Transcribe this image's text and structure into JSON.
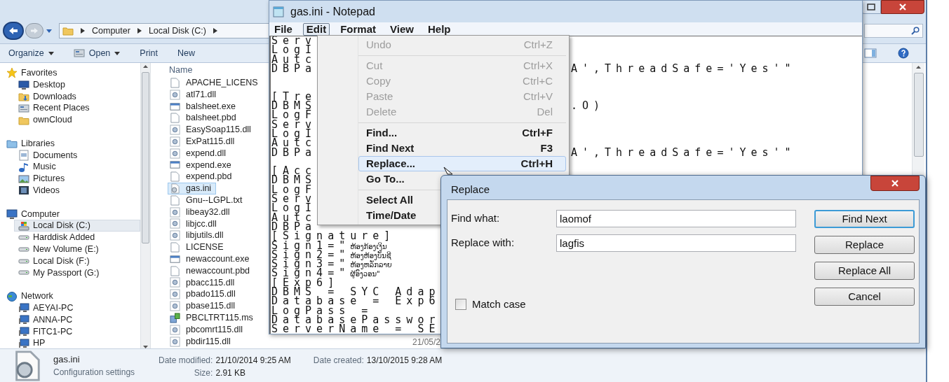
{
  "explorer": {
    "breadcrumb": [
      "Computer",
      "Local Disk (C:)"
    ],
    "toolbar": [
      {
        "label": "Organize",
        "kind": "menu"
      },
      {
        "label": "Open",
        "kind": "open"
      },
      {
        "label": "Print",
        "kind": "plain"
      },
      {
        "label": "New",
        "kind": "plain"
      }
    ],
    "nav": [
      {
        "label": "Favorites",
        "kind": "star",
        "selected": false,
        "children": [
          {
            "label": "Desktop",
            "kind": "desktop",
            "selected": false
          },
          {
            "label": "Downloads",
            "kind": "downloads",
            "selected": false
          },
          {
            "label": "Recent Places",
            "kind": "recent",
            "selected": false
          },
          {
            "label": "ownCloud",
            "kind": "folder",
            "selected": false
          }
        ]
      },
      {
        "label": "Libraries",
        "kind": "library",
        "selected": false,
        "children": [
          {
            "label": "Documents",
            "kind": "document",
            "selected": false
          },
          {
            "label": "Music",
            "kind": "music",
            "selected": false
          },
          {
            "label": "Pictures",
            "kind": "pictures",
            "selected": false
          },
          {
            "label": "Videos",
            "kind": "videos",
            "selected": false
          }
        ]
      },
      {
        "label": "Computer",
        "kind": "computer",
        "selected": false,
        "children": [
          {
            "label": "Local Disk (C:)",
            "kind": "os_drive",
            "selected": true
          },
          {
            "label": "Harddisk Added",
            "kind": "drive",
            "selected": false
          },
          {
            "label": "New Volume (E:)",
            "kind": "drive",
            "selected": false
          },
          {
            "label": "Local Disk (F:)",
            "kind": "drive",
            "selected": false
          },
          {
            "label": "My Passport (G:)",
            "kind": "drive",
            "selected": false
          }
        ]
      },
      {
        "label": "Network",
        "kind": "network",
        "selected": false,
        "children": [
          {
            "label": "AEYAI-PC",
            "kind": "pc",
            "selected": false
          },
          {
            "label": "ANNA-PC",
            "kind": "pc",
            "selected": false
          },
          {
            "label": "FITC1-PC",
            "kind": "pc",
            "selected": false
          },
          {
            "label": "HP",
            "kind": "pc",
            "selected": false
          }
        ]
      }
    ],
    "column_header": "Name",
    "files": [
      {
        "name": "APACHE_LICENS",
        "kind": "file",
        "selected": false
      },
      {
        "name": "atl71.dll",
        "kind": "dll",
        "selected": false
      },
      {
        "name": "balsheet.exe",
        "kind": "exe",
        "selected": false
      },
      {
        "name": "balsheet.pbd",
        "kind": "file",
        "selected": false
      },
      {
        "name": "EasySoap115.dll",
        "kind": "dll",
        "selected": false
      },
      {
        "name": "ExPat115.dll",
        "kind": "dll",
        "selected": false
      },
      {
        "name": "expend.dll",
        "kind": "dll",
        "selected": false
      },
      {
        "name": "expend.exe",
        "kind": "exe",
        "selected": false
      },
      {
        "name": "expend.pbd",
        "kind": "file",
        "selected": false
      },
      {
        "name": "gas.ini",
        "kind": "ini",
        "selected": true
      },
      {
        "name": "Gnu--LGPL.txt",
        "kind": "file",
        "selected": false
      },
      {
        "name": "libeay32.dll",
        "kind": "dll",
        "selected": false
      },
      {
        "name": "libjcc.dll",
        "kind": "dll",
        "selected": false
      },
      {
        "name": "libjutils.dll",
        "kind": "dll",
        "selected": false
      },
      {
        "name": "LICENSE",
        "kind": "file",
        "selected": false
      },
      {
        "name": "newaccount.exe",
        "kind": "exe",
        "selected": false
      },
      {
        "name": "newaccount.pbd",
        "kind": "file",
        "selected": false
      },
      {
        "name": "pbacc115.dll",
        "kind": "dll",
        "selected": false
      },
      {
        "name": "pbado115.dll",
        "kind": "dll",
        "selected": false
      },
      {
        "name": "pbase115.dll",
        "kind": "dll",
        "selected": false
      },
      {
        "name": "PBCLTRT115.ms",
        "kind": "msi",
        "selected": false
      },
      {
        "name": "pbcomrt115.dll",
        "kind": "dll",
        "selected": false
      },
      {
        "name": "pbdir115.dll",
        "kind": "dll",
        "selected": false,
        "date": "21/05/2"
      }
    ],
    "details": {
      "name": "gas.ini",
      "type": "Configuration settings",
      "modified_label": "Date modified:",
      "modified": "21/10/2014 9:25 AM",
      "size_label": "Size:",
      "size": "2.91 KB",
      "created_label": "Date created:",
      "created": "13/10/2015 9:28 AM"
    }
  },
  "notepad": {
    "title": "gas.ini - Notepad",
    "menu": [
      {
        "label": "File",
        "selected": false
      },
      {
        "label": "Edit",
        "selected": true
      },
      {
        "label": "Format",
        "selected": false
      },
      {
        "label": "View",
        "selected": false
      },
      {
        "label": "Help",
        "selected": false
      }
    ],
    "lines": [
      {
        "kind": "text",
        "text": "Serv"
      },
      {
        "kind": "text",
        "text": "LogI"
      },
      {
        "kind": "text",
        "text": "Autc"
      },
      {
        "kind": "text",
        "text": "DBPa",
        "right": "A',ThreadSafe='Yes'\""
      },
      {
        "kind": "blank"
      },
      {
        "kind": "blank"
      },
      {
        "kind": "text",
        "text": "[Tre"
      },
      {
        "kind": "text",
        "text": "DBMS",
        "right": ".O)"
      },
      {
        "kind": "text",
        "text": "LogF"
      },
      {
        "kind": "text",
        "text": "Serv"
      },
      {
        "kind": "text",
        "text": "LogI"
      },
      {
        "kind": "text",
        "text": "Autc"
      },
      {
        "kind": "text",
        "text": "DBPa",
        "right": "A',ThreadSafe='Yes'\""
      },
      {
        "kind": "blank"
      },
      {
        "kind": "text",
        "text": "[Acc"
      },
      {
        "kind": "text",
        "text": "DBMS"
      },
      {
        "kind": "text",
        "text": "LogF"
      },
      {
        "kind": "text",
        "text": "Serv"
      },
      {
        "kind": "text",
        "text": "LogI"
      },
      {
        "kind": "text",
        "text": "Autc"
      },
      {
        "kind": "text",
        "text": "DBPa"
      },
      {
        "kind": "text",
        "text": "[Signature]"
      },
      {
        "kind": "text",
        "text": "Sign1=\"",
        "tail": "ຫ້ອງກ້ອງເງິນ"
      },
      {
        "kind": "text",
        "text": "Sign2=\"",
        "tail": "ຫ້ອງຫ້ອງບັນຊີ"
      },
      {
        "kind": "text",
        "text": "Sign3=\"",
        "tail": "ຫ້ອງຫລັກລາຍ"
      },
      {
        "kind": "text",
        "text": "Sign4=\"",
        "tail": "ຜູ້ອົງວອນ\""
      },
      {
        "kind": "text",
        "text": "[Exp6]"
      },
      {
        "kind": "text",
        "text": "DBMS = SYC Adap"
      },
      {
        "kind": "text",
        "text": "Database = Exp6"
      },
      {
        "kind": "text",
        "text": "LogPass ="
      },
      {
        "kind": "text",
        "text": "DatabasePasswor"
      },
      {
        "kind": "text",
        "text": "ServerName = SE"
      }
    ],
    "edit_menu": [
      {
        "kind": "item",
        "label": "Undo",
        "shortcut": "Ctrl+Z",
        "disabled": true,
        "selected": false
      },
      {
        "kind": "separator"
      },
      {
        "kind": "item",
        "label": "Cut",
        "shortcut": "Ctrl+X",
        "disabled": true,
        "selected": false
      },
      {
        "kind": "item",
        "label": "Copy",
        "shortcut": "Ctrl+C",
        "disabled": true,
        "selected": false
      },
      {
        "kind": "item",
        "label": "Paste",
        "shortcut": "Ctrl+V",
        "disabled": true,
        "selected": false
      },
      {
        "kind": "item",
        "label": "Delete",
        "shortcut": "Del",
        "disabled": true,
        "selected": false
      },
      {
        "kind": "separator"
      },
      {
        "kind": "item",
        "label": "Find...",
        "shortcut": "Ctrl+F",
        "disabled": false,
        "selected": false
      },
      {
        "kind": "item",
        "label": "Find Next",
        "shortcut": "F3",
        "disabled": false,
        "selected": false
      },
      {
        "kind": "item",
        "label": "Replace...",
        "shortcut": "Ctrl+H",
        "disabled": false,
        "selected": true
      },
      {
        "kind": "item",
        "label": "Go To...",
        "disabled": false,
        "selected": false
      },
      {
        "kind": "separator"
      },
      {
        "kind": "item",
        "label": "Select All",
        "disabled": false,
        "selected": false
      },
      {
        "kind": "item",
        "label": "Time/Date",
        "disabled": false,
        "selected": false
      }
    ]
  },
  "replace_dialog": {
    "title": "Replace",
    "fields": [
      {
        "label": "Find what:",
        "value": "laomof"
      },
      {
        "label": "Replace with:",
        "value": "lagfis"
      }
    ],
    "match_case": {
      "label": "Match case",
      "checked": false
    },
    "buttons": [
      {
        "label": "Find Next",
        "focused": true
      },
      {
        "label": "Replace",
        "focused": false
      },
      {
        "label": "Replace All",
        "focused": false
      },
      {
        "label": "Cancel",
        "focused": false
      }
    ]
  }
}
